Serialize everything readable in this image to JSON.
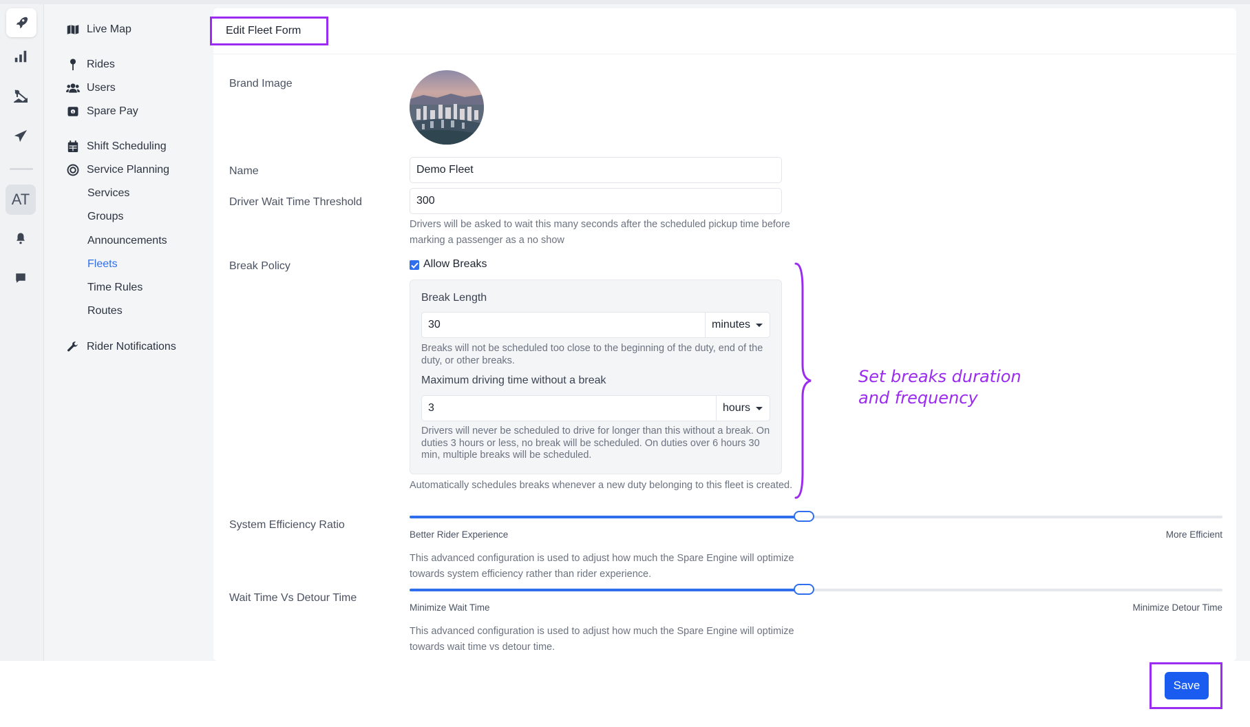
{
  "rail": {
    "initials": "AT"
  },
  "nav": {
    "live_map": "Live Map",
    "rides": "Rides",
    "users": "Users",
    "spare_pay": "Spare Pay",
    "shift_scheduling": "Shift Scheduling",
    "service_planning": "Service Planning",
    "services": "Services",
    "groups": "Groups",
    "announcements": "Announcements",
    "fleets": "Fleets",
    "time_rules": "Time Rules",
    "routes": "Routes",
    "rider_notifications": "Rider Notifications",
    "active_item": "Fleets"
  },
  "form": {
    "title": "Edit Fleet Form",
    "brand_image_label": "Brand Image",
    "name_label": "Name",
    "name_value": "Demo Fleet",
    "wait_label": "Driver Wait Time Threshold",
    "wait_value": "300",
    "wait_help": "Drivers will be asked to wait this many seconds after the scheduled pickup time before marking a passenger as a no show",
    "break_policy_label": "Break Policy",
    "allow_breaks_label": "Allow Breaks",
    "allow_breaks_checked": true,
    "break_length_label": "Break Length",
    "break_length_value": "30",
    "break_length_unit": "minutes",
    "break_length_help": "Breaks will not be scheduled too close to the beginning of the duty, end of the duty, or other breaks.",
    "max_driving_label": "Maximum driving time without a break",
    "max_driving_value": "3",
    "max_driving_unit": "hours",
    "max_driving_help": "Drivers will never be scheduled to drive for longer than this without a break. On duties 3 hours or less, no break will be scheduled. On duties over 6 hours 30 min, multiple breaks will be scheduled.",
    "break_policy_help": "Automatically schedules breaks whenever a new duty belonging to this fleet is created.",
    "efficiency_label": "System Efficiency Ratio",
    "efficiency_min": "Better Rider Experience",
    "efficiency_max": "More Efficient",
    "efficiency_value": 0.485,
    "efficiency_help": "This advanced configuration is used to adjust how much the Spare Engine will optimize towards system efficiency rather than rider experience.",
    "wait_detour_label": "Wait Time Vs Detour Time",
    "wait_detour_min": "Minimize Wait Time",
    "wait_detour_max": "Minimize Detour Time",
    "wait_detour_value": 0.485,
    "wait_detour_help": "This advanced configuration is used to adjust how much the Spare Engine will optimize towards wait time vs detour time.",
    "save_label": "Save"
  },
  "annotation": {
    "line1": "Set breaks duration",
    "line2": "and frequency"
  },
  "colors": {
    "accent": "#2f6fed",
    "save": "#1a5cf0",
    "highlight": "#9b2bf0"
  }
}
